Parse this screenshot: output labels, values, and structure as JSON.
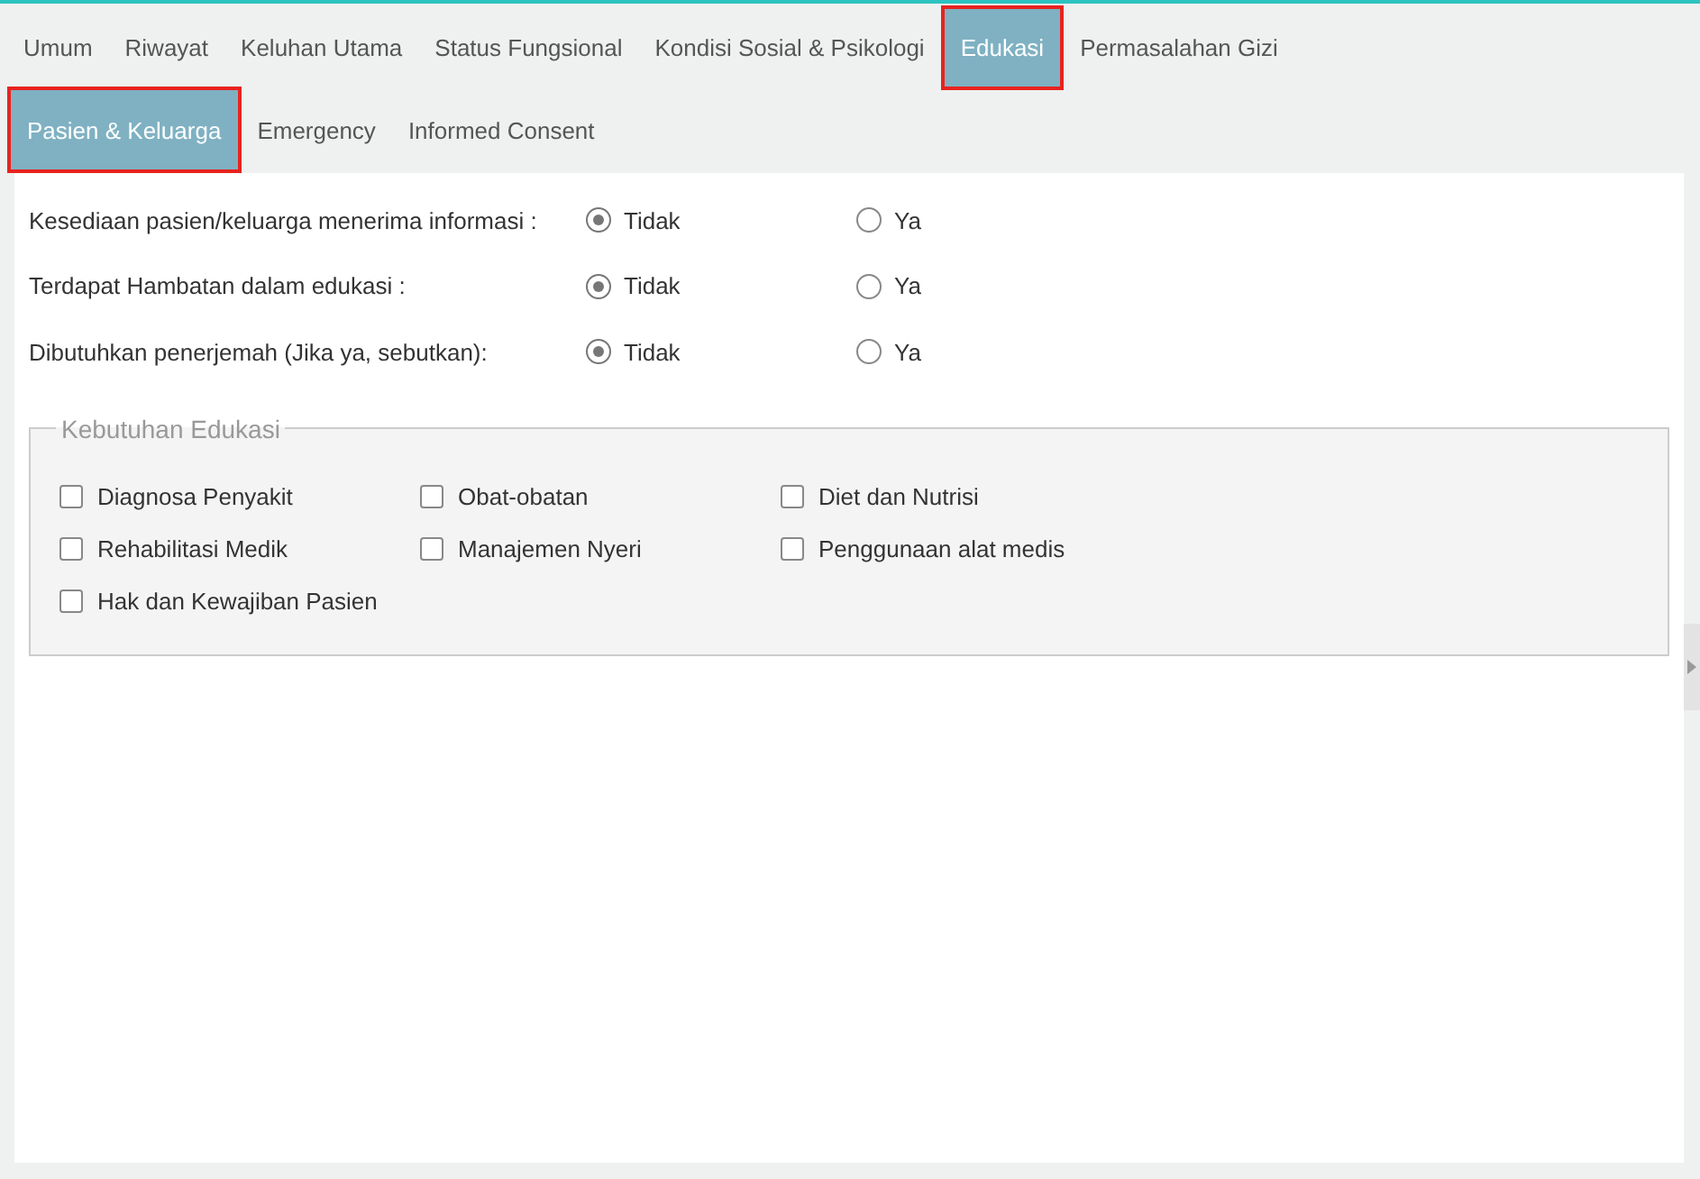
{
  "tab_rows": [
    [
      {
        "label": "Umum",
        "selected": false,
        "highlighted": false
      },
      {
        "label": "Riwayat",
        "selected": false,
        "highlighted": false
      },
      {
        "label": "Keluhan Utama",
        "selected": false,
        "highlighted": false
      },
      {
        "label": "Status Fungsional",
        "selected": false,
        "highlighted": false
      },
      {
        "label": "Kondisi Sosial & Psikologi",
        "selected": false,
        "highlighted": false
      },
      {
        "label": "Edukasi",
        "selected": true,
        "highlighted": true
      },
      {
        "label": "Permasalahan Gizi",
        "selected": false,
        "highlighted": false
      }
    ],
    [
      {
        "label": "Pasien & Keluarga",
        "selected": true,
        "highlighted": true
      },
      {
        "label": "Emergency",
        "selected": false,
        "highlighted": false
      },
      {
        "label": "Informed Consent",
        "selected": false,
        "highlighted": false
      }
    ]
  ],
  "questions": [
    {
      "label": "Kesediaan pasien/keluarga menerima informasi :",
      "options": [
        {
          "label": "Tidak",
          "selected": true
        },
        {
          "label": "Ya",
          "selected": false
        }
      ]
    },
    {
      "label": "Terdapat Hambatan dalam edukasi :",
      "options": [
        {
          "label": "Tidak",
          "selected": true
        },
        {
          "label": "Ya",
          "selected": false
        }
      ]
    },
    {
      "label": "Dibutuhkan penerjemah (Jika ya, sebutkan):",
      "options": [
        {
          "label": "Tidak",
          "selected": true
        },
        {
          "label": "Ya",
          "selected": false
        }
      ]
    }
  ],
  "education_needs": {
    "legend": "Kebutuhan Edukasi",
    "items": [
      {
        "label": "Diagnosa Penyakit",
        "checked": false
      },
      {
        "label": "Obat-obatan",
        "checked": false
      },
      {
        "label": "Diet dan Nutrisi",
        "checked": false
      },
      {
        "label": "Rehabilitasi Medik",
        "checked": false
      },
      {
        "label": "Manajemen Nyeri",
        "checked": false
      },
      {
        "label": "Penggunaan alat medis",
        "checked": false
      },
      {
        "label": "Hak dan Kewajiban Pasien",
        "checked": false
      }
    ]
  }
}
